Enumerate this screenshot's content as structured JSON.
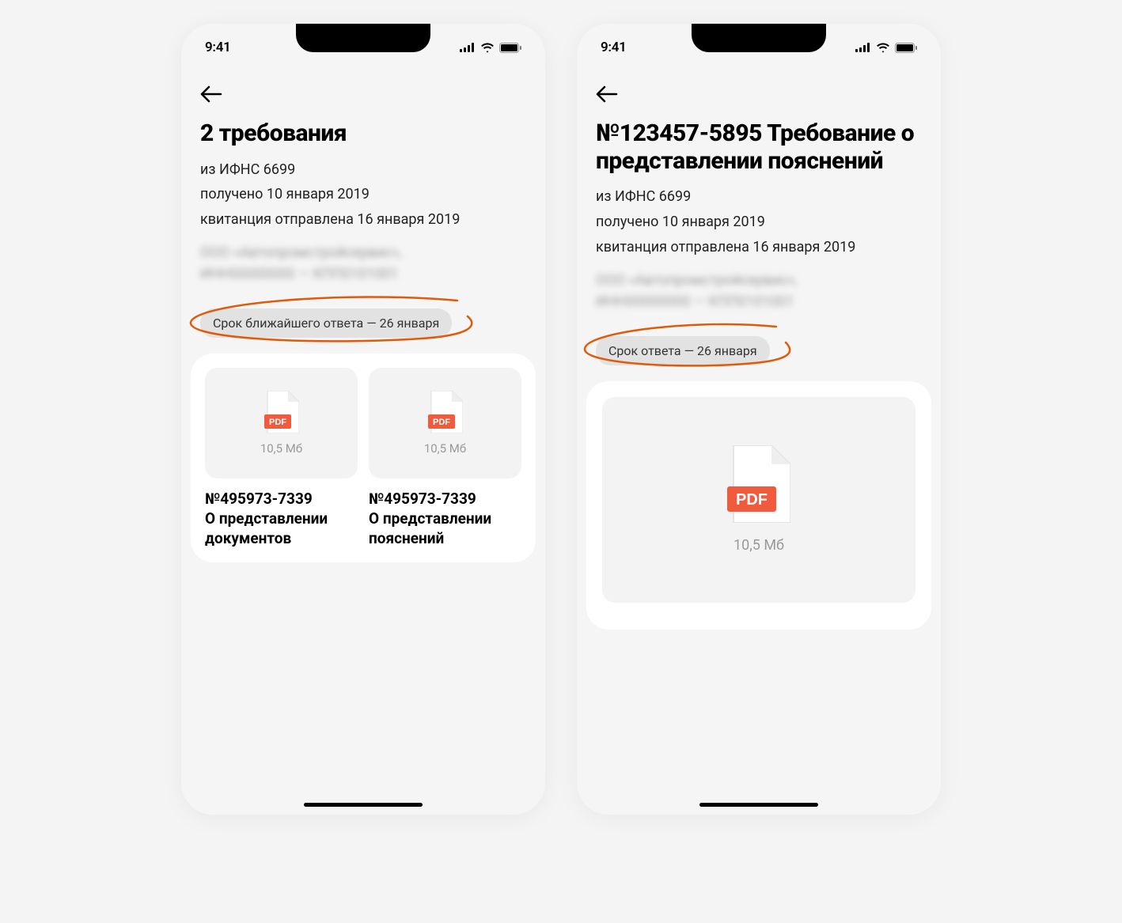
{
  "status_bar": {
    "time": "9:41"
  },
  "screen_left": {
    "title": "2 требования",
    "meta_source": "из ИФНС 6699",
    "meta_received": "получено 10 января 2019",
    "meta_receipt": "квитанция отправлена 16 января 2019",
    "org_blur_line1": "ООО «Автопромстройсервис»,",
    "org_blur_line2": "ИНН00000000 — КПП0101001",
    "deadline": "Срок ближайшего ответа — 26 января",
    "docs": [
      {
        "size": "10,5 Мб",
        "number": "№495973-7339",
        "desc": "О представлении документов"
      },
      {
        "size": "10,5 Мб",
        "number": "№495973-7339",
        "desc": "О представлении пояснений"
      }
    ]
  },
  "screen_right": {
    "title": "№123457-5895 Требование о представлении пояснений",
    "meta_source": "из ИФНС 6699",
    "meta_received": "получено 10 января 2019",
    "meta_receipt": "квитанция отправлена 16 января 2019",
    "org_blur_line1": "ООО «Автопромстройсервис»,",
    "org_blur_line2": "ИНН00000000 — КПП0101001",
    "deadline": "Срок ответа — 26 января",
    "doc": {
      "size": "10,5 Мб"
    }
  },
  "colors": {
    "pdf_red": "#f15a3d",
    "annotation": "#e05a0a"
  }
}
